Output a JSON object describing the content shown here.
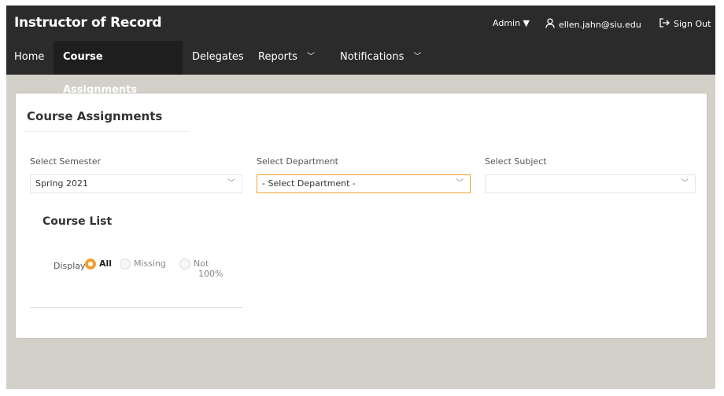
{
  "header": {
    "app_title": "Instructor of Record",
    "admin_menu": "Admin ▼",
    "user_email": "ellen.jahn@siu.edu",
    "sign_out": "Sign Out"
  },
  "nav": {
    "home": "Home",
    "course_assignments": "Course Assignments",
    "delegates": "Delegates",
    "reports": "Reports",
    "notifications": "Notifications"
  },
  "page": {
    "title": "Course Assignments",
    "semester_label": "Select Semester",
    "semester_value": "Spring 2021",
    "department_label": "Select Department",
    "department_value": "- Select Department -",
    "subject_label": "Select Subject",
    "subject_value": ""
  },
  "course_list": {
    "title": "Course List",
    "display_label": "Display",
    "options": [
      "All",
      "Missing",
      "Not",
      "100%"
    ],
    "selected": "All"
  },
  "colors": {
    "navbar": "#2b2b2b",
    "accent": "#f0a030",
    "background": "#d3d0c9"
  }
}
